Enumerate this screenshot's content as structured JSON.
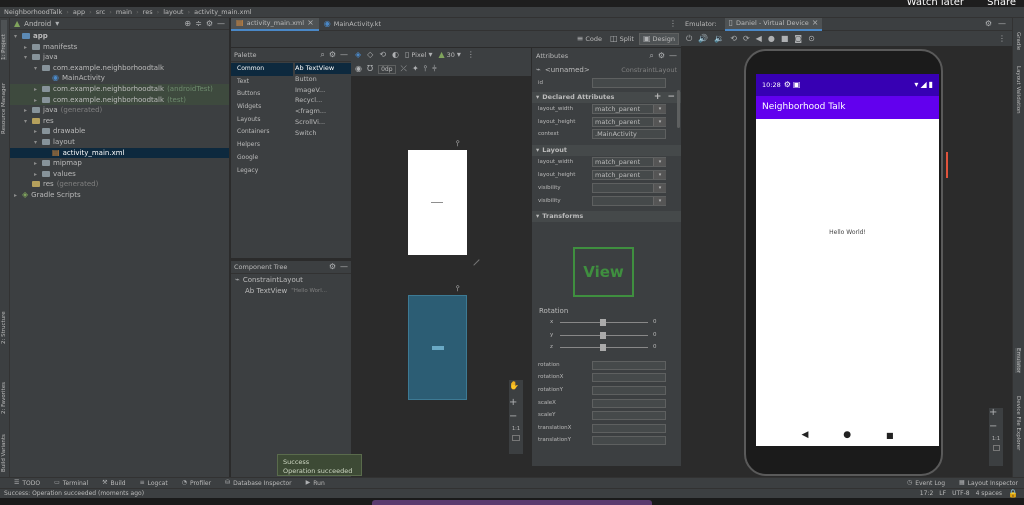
{
  "video_overlay": {
    "watch_later": "Watch later",
    "share": "Share"
  },
  "breadcrumb": [
    "NeighborhoodTalk",
    "app",
    "src",
    "main",
    "res",
    "layout",
    "activity_main.xml"
  ],
  "left_strip": [
    "1: Project",
    "Resource Manager",
    "2: Structure",
    "2: Favorites",
    "Build Variants"
  ],
  "right_strip": {
    "top": [
      "Gradle",
      "Layout Validation"
    ],
    "bottom": [
      "Emulator",
      "Device File Explorer"
    ]
  },
  "project": {
    "view_label": "Android",
    "tree": [
      {
        "label": "app",
        "level": 0,
        "arrow": "▾",
        "kind": "module",
        "bold": true
      },
      {
        "label": "manifests",
        "level": 1,
        "arrow": "▸",
        "kind": "folder"
      },
      {
        "label": "java",
        "level": 1,
        "arrow": "▾",
        "kind": "folder"
      },
      {
        "label": "com.example.neighborhoodtalk",
        "level": 2,
        "arrow": "▾",
        "kind": "package"
      },
      {
        "label": "MainActivity",
        "level": 3,
        "arrow": "",
        "kind": "class"
      },
      {
        "label": "com.example.neighborhoodtalk",
        "suffix": "(androidTest)",
        "level": 2,
        "arrow": "▸",
        "kind": "package",
        "highlight": true
      },
      {
        "label": "com.example.neighborhoodtalk",
        "suffix": "(test)",
        "level": 2,
        "arrow": "▸",
        "kind": "package",
        "highlight": true
      },
      {
        "label": "java",
        "suffix": "(generated)",
        "level": 1,
        "arrow": "▸",
        "kind": "folder"
      },
      {
        "label": "res",
        "level": 1,
        "arrow": "▾",
        "kind": "res"
      },
      {
        "label": "drawable",
        "level": 2,
        "arrow": "▸",
        "kind": "folder"
      },
      {
        "label": "layout",
        "level": 2,
        "arrow": "▾",
        "kind": "folder"
      },
      {
        "label": "activity_main.xml",
        "level": 3,
        "arrow": "",
        "kind": "xml",
        "selected": true
      },
      {
        "label": "mipmap",
        "level": 2,
        "arrow": "▸",
        "kind": "folder"
      },
      {
        "label": "values",
        "level": 2,
        "arrow": "▸",
        "kind": "folder"
      },
      {
        "label": "res",
        "suffix": "(generated)",
        "level": 1,
        "arrow": "",
        "kind": "res"
      },
      {
        "label": "Gradle Scripts",
        "level": 0,
        "arrow": "▸",
        "kind": "gradle"
      }
    ]
  },
  "editor_tabs": [
    {
      "label": "activity_main.xml",
      "active": true
    },
    {
      "label": "MainActivity.kt",
      "active": false
    }
  ],
  "view_modes": [
    "Code",
    "Split",
    "Design"
  ],
  "palette": {
    "title": "Palette",
    "categories": [
      "Common",
      "Text",
      "Buttons",
      "Widgets",
      "Layouts",
      "Containers",
      "Helpers",
      "Google",
      "Legacy"
    ],
    "items": [
      "Ab TextView",
      "Button",
      "ImageV...",
      "Recycl...",
      "<fragm...",
      "ScrollVi...",
      "Switch"
    ]
  },
  "component_tree": {
    "title": "Component Tree",
    "root": "ConstraintLayout",
    "child": "Ab TextView",
    "child_hint": "\"Hello Worl..."
  },
  "canvas_toolbar": {
    "device": "Pixel",
    "api": "30",
    "margin": "0dp"
  },
  "attributes": {
    "title": "Attributes",
    "component": "<unnamed>",
    "component_type": "ConstraintLayout",
    "id_label": "id",
    "declared": {
      "title": "Declared Attributes",
      "rows": [
        {
          "label": "layout_width",
          "value": "match_parent"
        },
        {
          "label": "layout_height",
          "value": "match_parent"
        },
        {
          "label": "context",
          "value": ".MainActivity"
        }
      ]
    },
    "layout": {
      "title": "Layout",
      "rows": [
        {
          "label": "layout_width",
          "value": "match_parent"
        },
        {
          "label": "layout_height",
          "value": "match_parent"
        },
        {
          "label": "visibility",
          "value": ""
        },
        {
          "label": "visibility",
          "value": ""
        }
      ]
    },
    "transforms": {
      "title": "Transforms",
      "view_label": "View",
      "rotation_label": "Rotation",
      "axes": [
        {
          "axis": "x",
          "value": "0"
        },
        {
          "axis": "y",
          "value": "0"
        },
        {
          "axis": "z",
          "value": "0"
        }
      ],
      "fields": [
        "rotation",
        "rotationX",
        "rotationY",
        "scaleX",
        "scaleY",
        "translationX",
        "translationY"
      ]
    }
  },
  "emulator": {
    "label": "Emulator:",
    "device_tab": "Daniel - Virtual Device",
    "time": "10:28",
    "app_title": "Neighborhood Talk",
    "content": "Hello World!",
    "zoom": "1:1"
  },
  "canvas_zoom": "1:1",
  "toast": {
    "title": "Success",
    "message": "Operation succeeded"
  },
  "bottom_tabs": [
    "TODO",
    "Terminal",
    "Build",
    "Logcat",
    "Profiler",
    "Database Inspector",
    "Run"
  ],
  "bottom_right_tabs": [
    "Event Log",
    "Layout Inspector"
  ],
  "status": {
    "message": "Success: Operation succeeded (moments ago)",
    "position": "17:2",
    "line_ending": "LF",
    "encoding": "UTF-8",
    "indent": "4 spaces"
  },
  "colors": {
    "accent": "#4a88c7",
    "app_bar": "#6200ee",
    "status_bar": "#3700b3",
    "blueprint": "#2c5d74",
    "transform_green": "#3f8f3f"
  }
}
